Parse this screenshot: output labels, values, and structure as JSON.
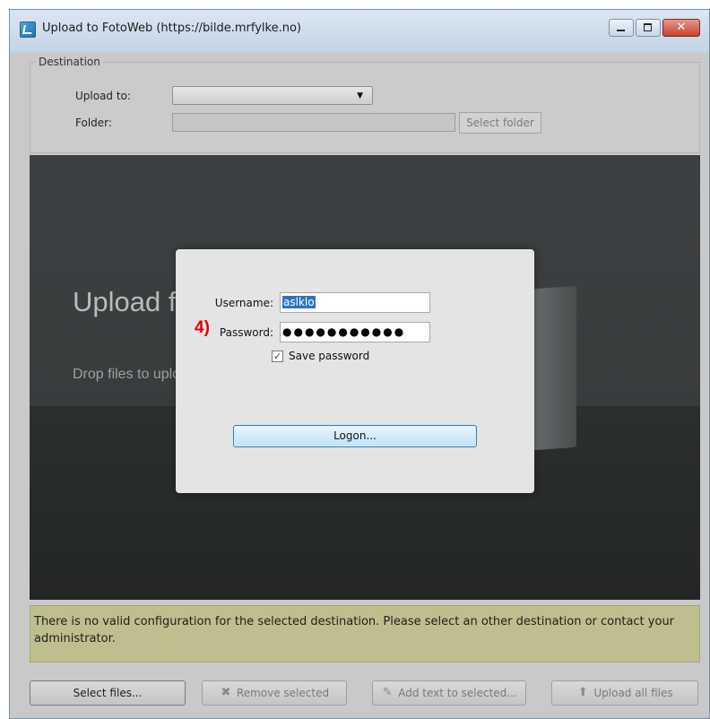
{
  "window": {
    "title": "Upload to FotoWeb (https://bilde.mrfylke.no)"
  },
  "destination": {
    "legend": "Destination",
    "upload_to_label": "Upload to:",
    "upload_to_value": "",
    "folder_label": "Folder:",
    "folder_value": "",
    "select_folder_label": "Select folder"
  },
  "dropzone": {
    "title": "Upload files",
    "subtitle": "Drop files to upload"
  },
  "message": "There is no valid configuration for the selected destination. Please select an other destination or contact your administrator.",
  "toolbar": {
    "select_files": "Select files...",
    "remove_selected": "Remove selected",
    "add_text": "Add text to selected...",
    "upload_all": "Upload all files"
  },
  "login": {
    "username_label": "Username:",
    "username_value": "aslklo",
    "password_label": "Password:",
    "password_masked": "●●●●●●●●●●●",
    "save_password_label": "Save password",
    "save_password_checked": true,
    "logon_label": "Logon..."
  },
  "annotation": {
    "step": "4)"
  },
  "colors": {
    "message_bg": "#bfbe8e",
    "drop_bg": "#3a3d3e",
    "annotation": "#e00000",
    "selection": "#2d73c2"
  },
  "icons": {
    "app": "fotoweb-icon",
    "remove": "remove-icon",
    "add_text": "edit-icon",
    "upload": "upload-arrow-icon"
  }
}
